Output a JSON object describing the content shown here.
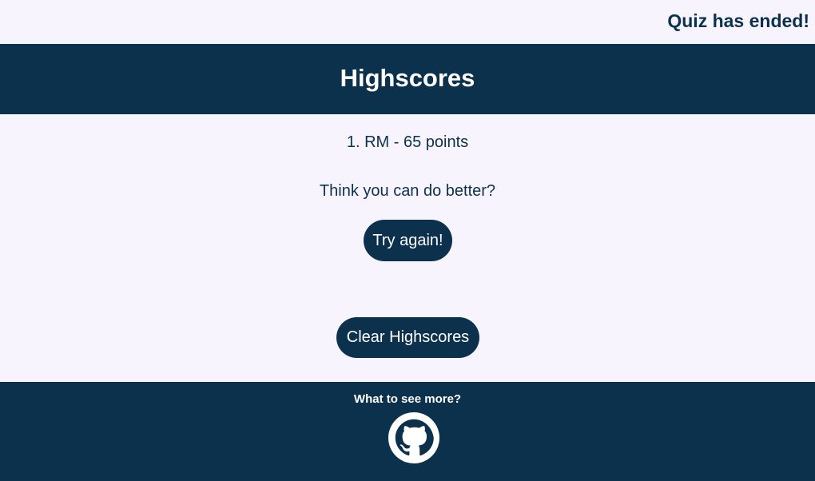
{
  "status": {
    "text": "Quiz has ended!"
  },
  "header": {
    "title": "Highscores"
  },
  "scores": [
    {
      "entry": "1. RM - 65 points"
    }
  ],
  "prompt": "Think you can do better?",
  "buttons": {
    "try_again": "Try again!",
    "clear": "Clear Highscores"
  },
  "footer": {
    "text": "What to see more?",
    "icon": "github-icon"
  },
  "colors": {
    "primary": "#0c314d",
    "background": "#f7f4fd",
    "text_on_primary": "#ffffff"
  }
}
